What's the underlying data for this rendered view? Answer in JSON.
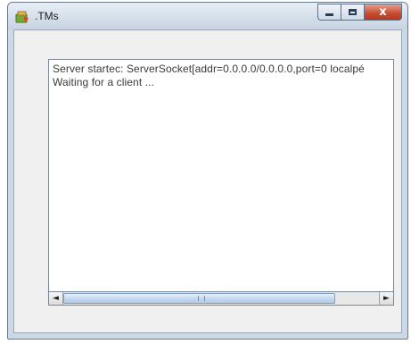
{
  "window": {
    "title": ".TMs",
    "close_glyph": "x",
    "icon": "java-app-icon"
  },
  "log": {
    "lines": [
      "Server startec: ServerSocket[addr=0.0.0.0/0.0.0.0,port=0 localpé",
      "Waiting for a client ..."
    ]
  },
  "scrollbar": {
    "left_arrow": "◄",
    "right_arrow": "►",
    "position_fraction": 0.0
  }
}
